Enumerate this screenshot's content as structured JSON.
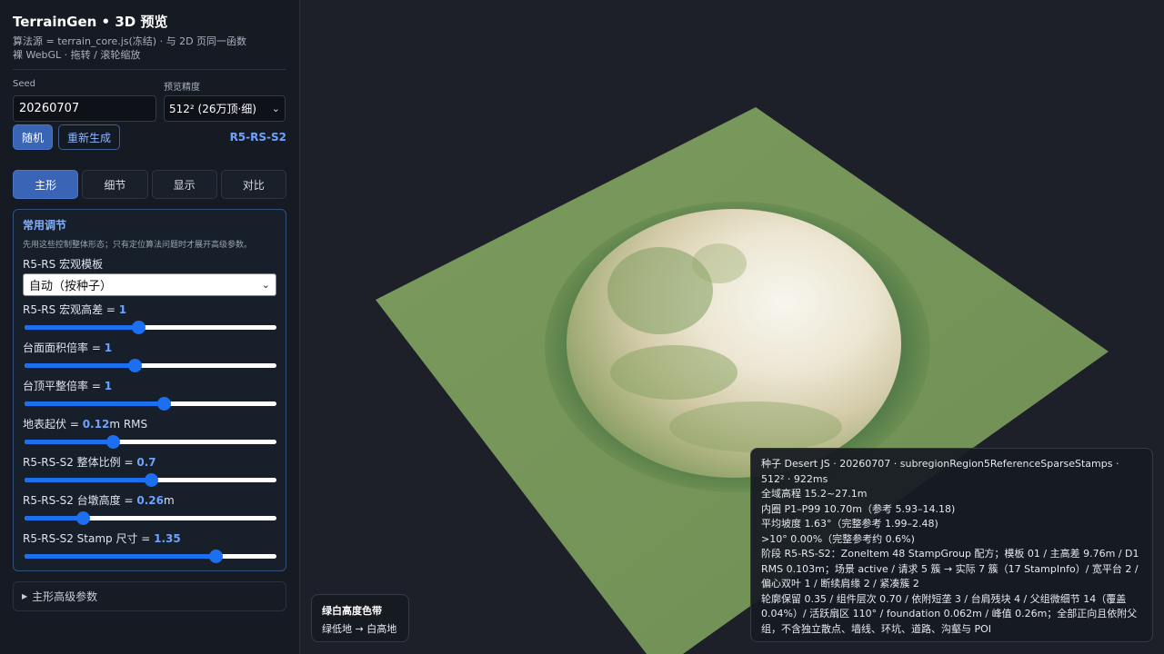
{
  "header": {
    "title": "TerrainGen • 3D 预览",
    "subtitle_line1": "算法源 = terrain_core.js(冻结) · 与 2D 页同一函数",
    "subtitle_line2": "裸 WebGL · 拖转 / 滚轮缩放"
  },
  "controls": {
    "seed_label": "Seed",
    "seed_value": "20260707",
    "precision_label": "预览精度",
    "precision_value": "512² (26万顶·细)",
    "random_button": "随机",
    "regenerate_button": "重新生成",
    "preset_code": "R5-RS-S2"
  },
  "tabs": [
    {
      "label": "主形",
      "active": true
    },
    {
      "label": "细节",
      "active": false
    },
    {
      "label": "显示",
      "active": false
    },
    {
      "label": "对比",
      "active": false
    }
  ],
  "panel": {
    "title": "常用调节",
    "hint": "先用这些控制整体形态；只有定位算法问题时才展开高级参数。",
    "template_label": "R5-RS 宏观模板",
    "template_value": "自动（按种子）",
    "sliders": [
      {
        "name": "R5-RS 宏观高差",
        "prefix": " = ",
        "value": "1",
        "suffix": "",
        "fraction": 0.45
      },
      {
        "name": "台面面积倍率",
        "prefix": " = ",
        "value": "1",
        "suffix": "",
        "fraction": 0.435
      },
      {
        "name": "台顶平整倍率",
        "prefix": " = ",
        "value": "1",
        "suffix": "",
        "fraction": 0.55
      },
      {
        "name": "地表起伏",
        "prefix": " = ",
        "value": "0.12",
        "suffix": "m RMS",
        "fraction": 0.35
      },
      {
        "name": "R5-RS-S2 整体比例",
        "prefix": " = ",
        "value": "0.7",
        "suffix": "",
        "fraction": 0.5
      },
      {
        "name": "R5-RS-S2 台墩高度",
        "prefix": " = ",
        "value": "0.26",
        "suffix": "m",
        "fraction": 0.23
      },
      {
        "name": "R5-RS-S2 Stamp 尺寸",
        "prefix": " = ",
        "value": "1.35",
        "suffix": "",
        "fraction": 0.755
      }
    ]
  },
  "advanced": {
    "arrow": "▶",
    "label": "主形高级参数"
  },
  "legend": {
    "title": "绿白高度色带",
    "description": "绿低地 → 白高地"
  },
  "stats": {
    "line1": "种子 Desert JS · 20260707 · subregionRegion5ReferenceSparseStamps · 512² · 922ms",
    "line2": "全域高程 15.2~27.1m",
    "line3": "内圈 P1–P99 10.70m（参考 5.93–14.18)",
    "line4": "平均坡度 1.63°（完整参考 1.99–2.48)",
    "line5": ">10° 0.00%（完整参考约 0.6%)",
    "line6": "阶段 R5-RS-S2：ZoneItem 48 StampGroup 配方；模板 01 / 主高差 9.76m / D1 RMS 0.103m；场景 active / 请求 5 簇 → 实际 7 簇（17 StampInfo）/ 宽平台 2 / 偏心双叶 1 / 断续肩缘 2 / 紧凑簇 2",
    "line7": "轮廓保留 0.35 / 组件层次 0.70 / 依附短垄 3 / 台肩残块 4 / 父组微细节 14（覆盖 0.04%）/ 活跃扇区 110° / foundation 0.062m / 峰值 0.26m；全部正向且依附父组，不含独立散点、墙线、环坑、道路、沟壑与 POI"
  },
  "colors": {
    "accent": "#3a64b5",
    "slider": "#1d6ff2",
    "terrain_low": "#7c9a5c",
    "terrain_high": "#f2efe6"
  }
}
